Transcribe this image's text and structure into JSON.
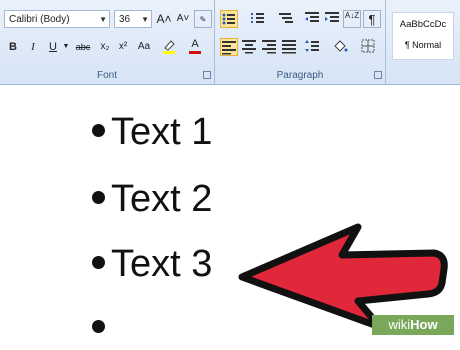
{
  "font_group": {
    "label": "Font",
    "font_name": "Calibri (Body)",
    "font_size": "36",
    "bold_label": "B",
    "italic_label": "I",
    "underline_label": "U",
    "strike_label": "abc",
    "subscript_label": "x₂",
    "superscript_label": "x²",
    "change_case_label": "Aa",
    "grow_label": "A˄",
    "shrink_label": "A˅",
    "font_color_label": "A",
    "highlight_color": "#ffff00",
    "font_color": "#d01010"
  },
  "paragraph_group": {
    "label": "Paragraph",
    "sort_label": "A↓Z",
    "pilcrow_label": "¶"
  },
  "styles_group": {
    "sample_text": "AaBbCcDc",
    "style_name": "¶ Normal"
  },
  "document": {
    "bullet_lines": [
      "Text 1",
      "Text 2",
      "Text 3",
      ""
    ]
  },
  "arrow": {
    "fill": "#e0283a",
    "stroke": "#111111"
  },
  "watermark": {
    "prefix": "wiki",
    "suffix": "How"
  }
}
